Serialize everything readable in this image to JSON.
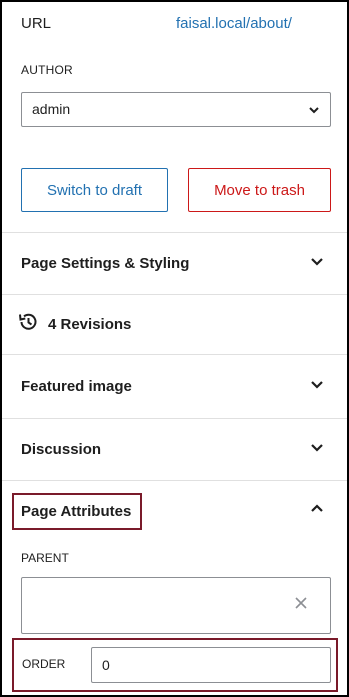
{
  "url": {
    "label": "URL",
    "value": "faisal.local/about/"
  },
  "author": {
    "label": "AUTHOR",
    "selected": "admin"
  },
  "actions": {
    "draft_label": "Switch to draft",
    "trash_label": "Move to trash"
  },
  "panels": {
    "page_settings": "Page Settings & Styling",
    "revisions": "4 Revisions",
    "featured_image": "Featured image",
    "discussion": "Discussion",
    "page_attributes": "Page Attributes"
  },
  "attributes": {
    "parent_label": "PARENT",
    "parent_value": "",
    "order_label": "ORDER",
    "order_value": "0"
  },
  "colors": {
    "link": "#2271b1",
    "danger": "#cc1818",
    "highlight": "#7a1a2a"
  }
}
